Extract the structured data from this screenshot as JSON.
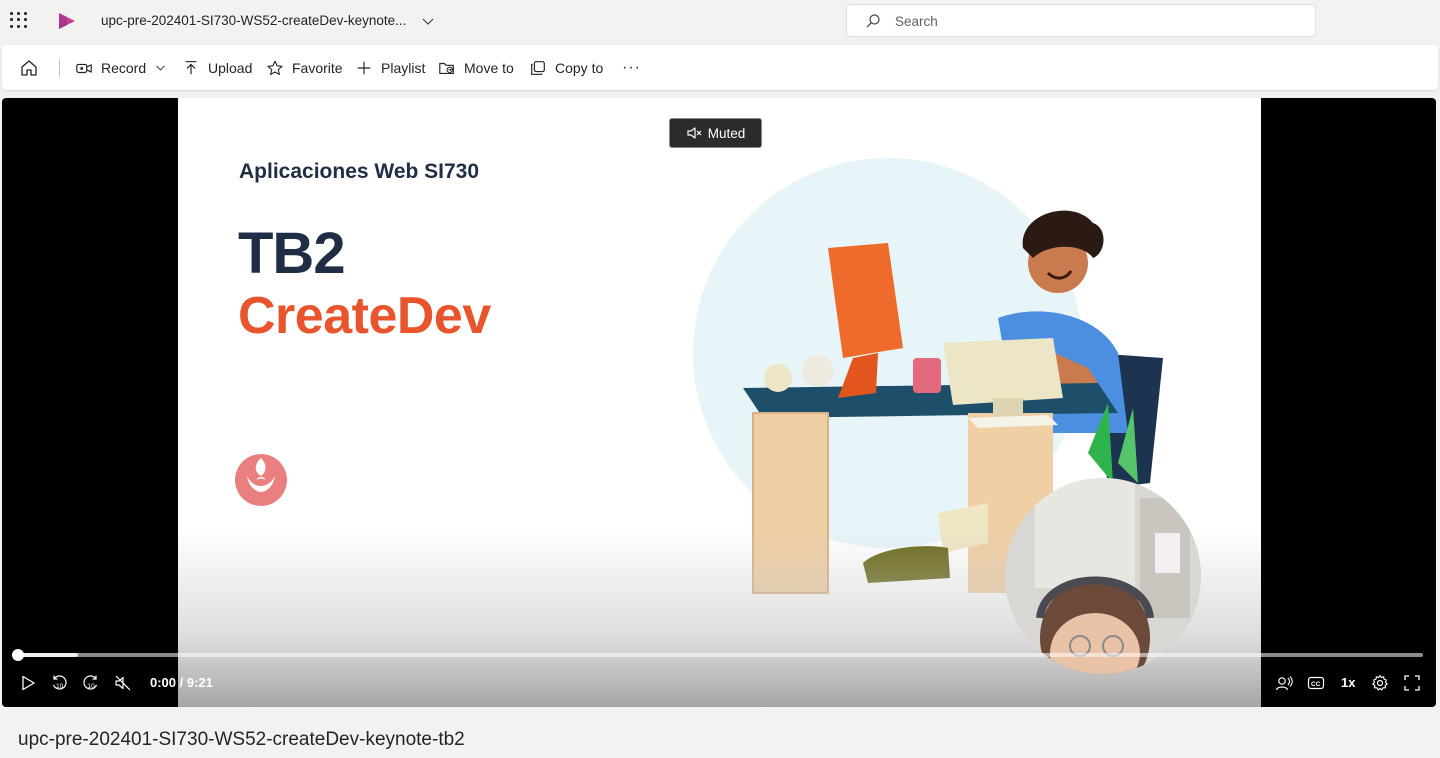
{
  "app": {
    "document_title": "upc-pre-202401-SI730-WS52-createDev-keynote...",
    "search_placeholder": "Search"
  },
  "toolbar": {
    "record_label": "Record",
    "upload_label": "Upload",
    "favorite_label": "Favorite",
    "playlist_label": "Playlist",
    "move_label": "Move to",
    "copy_label": "Copy to",
    "more_label": "···"
  },
  "player": {
    "muted_label": "Muted",
    "time_display": "0:00 / 9:21",
    "speed_label": "1x",
    "progress_fraction": 0.0,
    "slide": {
      "subtitle": "Aplicaciones Web SI730",
      "title_line1": "TB2",
      "title_line2": "CreateDev"
    }
  },
  "video": {
    "title": "upc-pre-202401-SI730-WS52-createDev-keynote-tb2"
  },
  "colors": {
    "accent_orange": "#e8552d",
    "navy": "#1f2d45",
    "stream_brand": "#c2348f"
  },
  "icons": [
    "app-launcher-icon",
    "stream-logo-icon",
    "chevron-down-icon",
    "search-icon",
    "home-icon",
    "record-icon",
    "upload-icon",
    "star-icon",
    "plus-icon",
    "move-icon",
    "copy-icon",
    "more-icon",
    "speaker-muted-icon",
    "play-icon",
    "rewind-10-icon",
    "forward-10-icon",
    "volume-muted-icon",
    "noise-suppression-icon",
    "captions-icon",
    "settings-gear-icon",
    "fullscreen-icon"
  ]
}
